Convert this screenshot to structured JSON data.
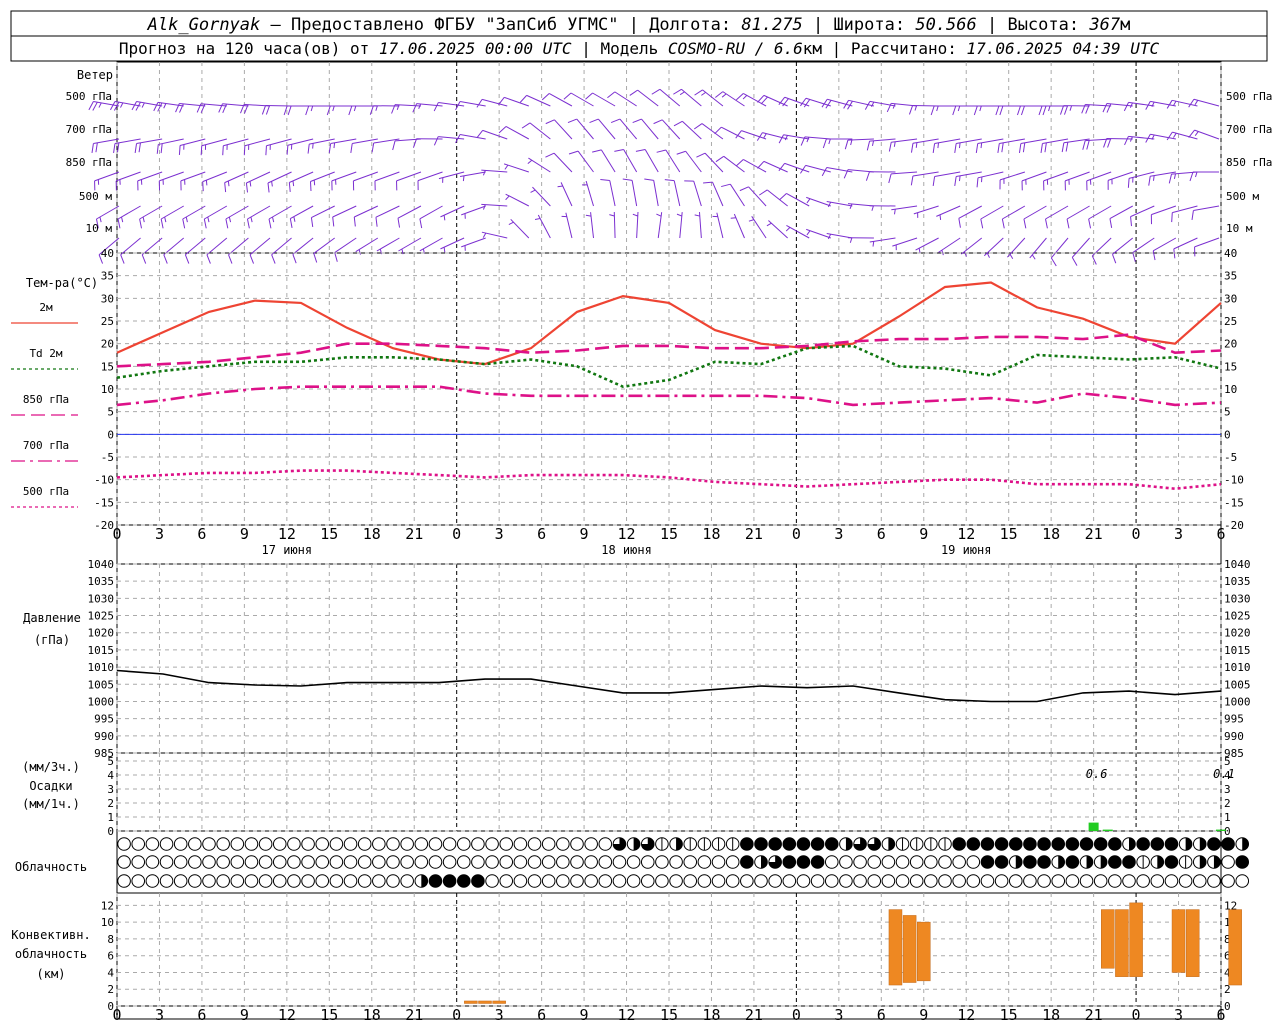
{
  "header": {
    "line1": [
      {
        "text": "Alk_Gornyak",
        "italic": true
      },
      {
        "text": " – Предоставлено ФГБУ \"ЗапСиб УГМС\" | Долгота: ",
        "italic": false
      },
      {
        "text": "81.275",
        "italic": true
      },
      {
        "text": " | Широта: ",
        "italic": false
      },
      {
        "text": "50.566",
        "italic": true
      },
      {
        "text": " | Высота: ",
        "italic": false
      },
      {
        "text": "367",
        "italic": true
      },
      {
        "text": "м",
        "italic": false
      }
    ],
    "line2": [
      {
        "text": "Прогноз на 120 часа(ов) от ",
        "italic": false
      },
      {
        "text": "17.06.2025 00:00 UTC",
        "italic": true
      },
      {
        "text": "  | Модель ",
        "italic": false
      },
      {
        "text": "COSMO-RU / 6.6",
        "italic": true
      },
      {
        "text": "км | Рассчитано: ",
        "italic": false
      },
      {
        "text": "17.06.2025 04:39 UTC",
        "italic": true
      }
    ]
  },
  "x_ticks": [
    "0",
    "3",
    "6",
    "9",
    "12",
    "15",
    "18",
    "21",
    "0",
    "3",
    "6",
    "9",
    "12",
    "15",
    "18",
    "21",
    "0",
    "3",
    "6",
    "9",
    "12",
    "15",
    "18",
    "21",
    "0",
    "3",
    "6"
  ],
  "day_labels": [
    "17 июня",
    "18 июня",
    "19 июня"
  ],
  "wind": {
    "title": "Ветер",
    "levels": [
      "500 гПа",
      "700 гПа",
      "850 гПа",
      "500 м",
      "10 м"
    ],
    "color": "#7b2fd0",
    "series": [
      {
        "level": "500 гПа",
        "dir": [
          280,
          280,
          275,
          275,
          270,
          270,
          270,
          275,
          280,
          290,
          300,
          300,
          310,
          310,
          300,
          290,
          285,
          280,
          270,
          270,
          270,
          270,
          275,
          280,
          285
        ],
        "speed": [
          25,
          25,
          20,
          20,
          20,
          15,
          15,
          15,
          10,
          10,
          10,
          10,
          10,
          15,
          15,
          20,
          20,
          15,
          15,
          15,
          20,
          25,
          20,
          15,
          15
        ]
      },
      {
        "level": "700 гПа",
        "dir": [
          260,
          260,
          255,
          255,
          255,
          260,
          260,
          270,
          280,
          300,
          320,
          320,
          320,
          310,
          290,
          280,
          270,
          265,
          260,
          260,
          260,
          260,
          270,
          280,
          290
        ],
        "speed": [
          20,
          20,
          15,
          15,
          15,
          15,
          10,
          10,
          10,
          10,
          10,
          10,
          10,
          10,
          10,
          15,
          15,
          15,
          15,
          15,
          20,
          20,
          20,
          15,
          15
        ]
      },
      {
        "level": "850 гПа",
        "dir": [
          250,
          250,
          250,
          245,
          245,
          250,
          250,
          250,
          260,
          290,
          320,
          330,
          330,
          320,
          300,
          290,
          280,
          270,
          260,
          260,
          250,
          250,
          250,
          260,
          270
        ],
        "speed": [
          15,
          15,
          15,
          15,
          15,
          15,
          10,
          10,
          5,
          5,
          10,
          10,
          10,
          10,
          10,
          10,
          10,
          10,
          10,
          15,
          15,
          15,
          15,
          15,
          15
        ]
      },
      {
        "level": "500 м",
        "dir": [
          240,
          240,
          240,
          240,
          240,
          245,
          245,
          240,
          250,
          300,
          340,
          350,
          350,
          340,
          320,
          300,
          280,
          270,
          250,
          240,
          240,
          240,
          240,
          250,
          260
        ],
        "speed": [
          15,
          15,
          15,
          15,
          15,
          10,
          10,
          10,
          5,
          5,
          5,
          10,
          10,
          10,
          10,
          10,
          5,
          5,
          5,
          10,
          10,
          10,
          10,
          10,
          10
        ]
      },
      {
        "level": "10 м",
        "dir": [
          230,
          230,
          230,
          230,
          230,
          235,
          240,
          240,
          250,
          320,
          350,
          360,
          10,
          350,
          330,
          300,
          280,
          260,
          240,
          230,
          220,
          220,
          230,
          240,
          250
        ],
        "speed": [
          10,
          10,
          10,
          10,
          10,
          10,
          5,
          5,
          5,
          5,
          5,
          5,
          5,
          5,
          5,
          5,
          5,
          5,
          5,
          5,
          5,
          10,
          10,
          10,
          10
        ]
      }
    ]
  },
  "chart_data": [
    {
      "type": "line",
      "ylabel": "Тем-ра(°С)",
      "ylim": [
        -20,
        40
      ],
      "yticks": [
        -20,
        -15,
        -10,
        -5,
        0,
        5,
        10,
        15,
        20,
        25,
        30,
        35,
        40
      ],
      "x_hours": [
        0,
        3,
        6,
        9,
        12,
        15,
        18,
        21,
        24,
        27,
        30,
        33,
        36,
        39,
        42,
        45,
        48,
        51,
        54,
        57,
        60,
        63,
        66,
        69,
        72
      ],
      "series": [
        {
          "name": "2м",
          "color": "#ee4433",
          "style": "solid",
          "values": [
            18,
            22.5,
            27,
            29.5,
            29,
            23.5,
            19,
            16.5,
            15.5,
            19,
            27,
            30.5,
            29,
            23,
            20,
            19,
            20,
            26,
            32.5,
            33.5,
            28,
            25.5,
            21.5,
            20,
            29
          ]
        },
        {
          "name": "Td  2м",
          "color": "#117711",
          "style": "dotted",
          "values": [
            12.5,
            14,
            15,
            16,
            16,
            17,
            17,
            16.5,
            15.5,
            16.5,
            15,
            10.5,
            12,
            16,
            15.5,
            19,
            19.5,
            15,
            14.5,
            13,
            17.5,
            17,
            16.5,
            17,
            14.5
          ]
        },
        {
          "name": "850 гПа",
          "color": "#dd1188",
          "style": "dashed",
          "values": [
            15,
            15.5,
            16,
            17,
            18,
            20,
            20,
            19.5,
            19,
            18,
            18.5,
            19.5,
            19.5,
            19,
            19,
            19.5,
            20.5,
            21,
            21,
            21.5,
            21.5,
            21,
            22,
            18,
            18.5
          ]
        },
        {
          "name": "700 гПа",
          "color": "#dd1188",
          "style": "dashdot",
          "values": [
            6.5,
            7.5,
            9,
            10,
            10.5,
            10.5,
            10.5,
            10.5,
            9,
            8.5,
            8.5,
            8.5,
            8.5,
            8.5,
            8.5,
            8,
            6.5,
            7,
            7.5,
            8,
            7,
            9,
            8,
            6.5,
            7
          ]
        },
        {
          "name": "500 гПа",
          "color": "#dd1188",
          "style": "dotted",
          "values": [
            -9.5,
            -9,
            -8.5,
            -8.5,
            -8,
            -8,
            -8.5,
            -9,
            -9.5,
            -9,
            -9,
            -9,
            -9.5,
            -10.5,
            -11,
            -11.5,
            -11,
            -10.5,
            -10,
            -10,
            -11,
            -11,
            -11,
            -12,
            -11
          ]
        }
      ]
    },
    {
      "type": "line",
      "ylabel": "Давление",
      "yunit": "(гПа)",
      "ylim": [
        985,
        1040
      ],
      "yticks": [
        985,
        990,
        995,
        1000,
        1005,
        1010,
        1015,
        1020,
        1025,
        1030,
        1035,
        1040
      ],
      "x_hours": [
        0,
        3,
        6,
        9,
        12,
        15,
        18,
        21,
        24,
        27,
        30,
        33,
        36,
        39,
        42,
        45,
        48,
        51,
        54,
        57,
        60,
        63,
        66,
        69,
        72
      ],
      "series": [
        {
          "name": "Давление",
          "color": "#000000",
          "style": "solid",
          "values": [
            1009,
            1008,
            1005.5,
            1004.8,
            1004.5,
            1005.5,
            1005.5,
            1005.5,
            1006.5,
            1006.5,
            1004.5,
            1002.5,
            1002.5,
            1003.5,
            1004.5,
            1004,
            1004.5,
            1002.5,
            1000.5,
            1000,
            1000,
            1002.5,
            1003,
            1002,
            1003
          ]
        }
      ]
    },
    {
      "type": "bar",
      "ylabel": "Осадки",
      "yunit_top": "(мм/3ч.)",
      "yunit_bottom": "(мм/1ч.)",
      "ylim": [
        0,
        5
      ],
      "yticks": [
        0,
        1,
        2,
        3,
        4,
        5
      ],
      "color": "#22cc22",
      "bars": [
        {
          "hour": 69,
          "value": 0.6
        },
        {
          "hour": 70,
          "value": 0.1
        },
        {
          "hour": 78,
          "value": 0.1
        }
      ],
      "labels": [
        {
          "hour": 69,
          "text": "0.6"
        },
        {
          "hour": 78,
          "text": "0.1"
        }
      ]
    },
    {
      "type": "bar",
      "ylabel": "Конвективн.",
      "ylabel2": "облачность",
      "yunit": "(км)",
      "ylim": [
        0,
        13
      ],
      "yticks": [
        0,
        2,
        4,
        6,
        8,
        10,
        12
      ],
      "color": "#ee8822",
      "bars": [
        {
          "hour": 25,
          "bottom": 0.3,
          "top": 0.6
        },
        {
          "hour": 26,
          "bottom": 0.3,
          "top": 0.6
        },
        {
          "hour": 27,
          "bottom": 0.3,
          "top": 0.6
        },
        {
          "hour": 55,
          "bottom": 2.5,
          "top": 11.5
        },
        {
          "hour": 56,
          "bottom": 2.8,
          "top": 10.8
        },
        {
          "hour": 57,
          "bottom": 3.0,
          "top": 10.0
        },
        {
          "hour": 70,
          "bottom": 4.5,
          "top": 11.5
        },
        {
          "hour": 71,
          "bottom": 3.5,
          "top": 11.5
        },
        {
          "hour": 72,
          "bottom": 3.5,
          "top": 12.3
        },
        {
          "hour": 75,
          "bottom": 4.0,
          "top": 11.5
        },
        {
          "hour": 76,
          "bottom": 3.5,
          "top": 11.5
        },
        {
          "hour": 79,
          "bottom": 2.5,
          "top": 11.5
        }
      ]
    }
  ],
  "clouds": {
    "title": "Облачность",
    "rows": [
      {
        "runs": [
          [
            0,
            35,
            0
          ],
          [
            35,
            36,
            3
          ],
          [
            36,
            37,
            2
          ],
          [
            37,
            38,
            3
          ],
          [
            38,
            39,
            1
          ],
          [
            39,
            40,
            2
          ],
          [
            40,
            44,
            1
          ],
          [
            44,
            51,
            4
          ],
          [
            51,
            52,
            2
          ],
          [
            52,
            54,
            3
          ],
          [
            54,
            55,
            2
          ],
          [
            55,
            59,
            1
          ],
          [
            59,
            68,
            4
          ],
          [
            68,
            71,
            4
          ],
          [
            71,
            72,
            2
          ],
          [
            72,
            75,
            4
          ],
          [
            75,
            77,
            2
          ],
          [
            77,
            79,
            4
          ],
          [
            79,
            80,
            2
          ]
        ]
      },
      {
        "runs": [
          [
            0,
            44,
            0
          ],
          [
            44,
            45,
            4
          ],
          [
            45,
            46,
            2
          ],
          [
            46,
            47,
            3
          ],
          [
            47,
            50,
            4
          ],
          [
            50,
            61,
            0
          ],
          [
            61,
            63,
            4
          ],
          [
            63,
            64,
            2
          ],
          [
            64,
            66,
            4
          ],
          [
            66,
            67,
            2
          ],
          [
            67,
            68,
            4
          ],
          [
            68,
            70,
            2
          ],
          [
            70,
            72,
            4
          ],
          [
            72,
            73,
            1
          ],
          [
            73,
            74,
            2
          ],
          [
            74,
            75,
            4
          ],
          [
            75,
            76,
            1
          ],
          [
            76,
            78,
            2
          ],
          [
            78,
            79,
            0
          ],
          [
            79,
            80,
            4
          ]
        ]
      },
      {
        "runs": [
          [
            0,
            21,
            0
          ],
          [
            21,
            22,
            2
          ],
          [
            22,
            26,
            4
          ],
          [
            26,
            80,
            0
          ]
        ]
      }
    ]
  }
}
